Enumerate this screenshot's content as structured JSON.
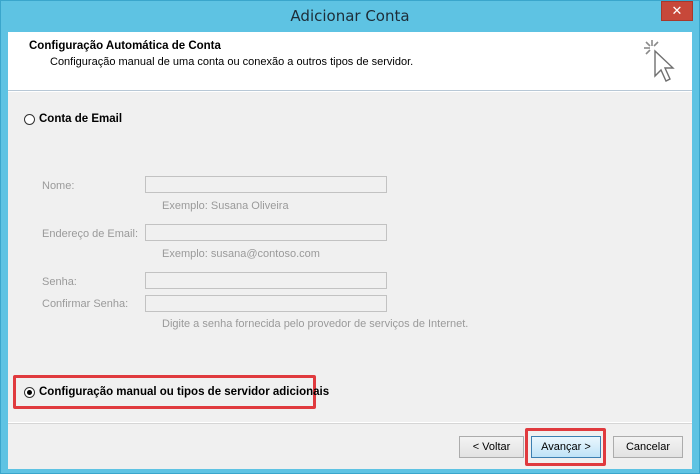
{
  "window": {
    "title": "Adicionar Conta",
    "close_glyph": "✕"
  },
  "header": {
    "title": "Configuração Automática de Conta",
    "subtitle": "Configuração manual de uma conta ou conexão a outros tipos de servidor.",
    "icon": "wizard-cursor-icon"
  },
  "email_option": {
    "label": "Conta de Email",
    "selected": false
  },
  "fields": {
    "name": {
      "label": "Nome:",
      "value": "",
      "hint": "Exemplo: Susana Oliveira"
    },
    "email": {
      "label": "Endereço de Email:",
      "value": "",
      "hint": "Exemplo: susana@contoso.com"
    },
    "password": {
      "label": "Senha:",
      "value": ""
    },
    "confirm_password": {
      "label": "Confirmar Senha:",
      "value": "",
      "hint": "Digite a senha fornecida pelo provedor de serviços de Internet."
    }
  },
  "manual_option": {
    "label": "Configuração manual ou tipos de servidor adicionais",
    "selected": true
  },
  "buttons": {
    "back": "< Voltar",
    "next": "Avançar >",
    "cancel": "Cancelar"
  },
  "colors": {
    "frame": "#5ec3e3",
    "highlight": "#e03a3e",
    "close": "#c7483a"
  }
}
